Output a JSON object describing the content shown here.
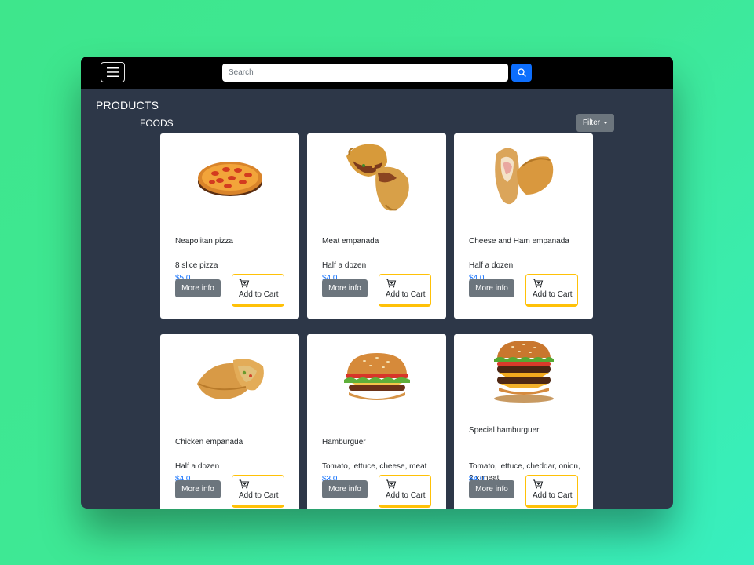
{
  "header": {
    "search_placeholder": "Search"
  },
  "page": {
    "title": "PRODUCTS",
    "section": "FOODS",
    "filter_label": "Filter"
  },
  "buttons": {
    "more_info": "More info",
    "add_to_cart": "Add to Cart"
  },
  "products": [
    {
      "name": "Neapolitan pizza",
      "description": "8 slice pizza",
      "price": "$5.0",
      "image": "pizza"
    },
    {
      "name": "Meat empanada",
      "description": "Half a dozen",
      "price": "$4.0",
      "image": "empanada"
    },
    {
      "name": "Cheese and Ham empanada",
      "description": "Half a dozen",
      "price": "$4.0",
      "image": "empanada-light"
    },
    {
      "name": "Chicken empanada",
      "description": "Half a dozen",
      "price": "$4.0",
      "image": "empanada-open"
    },
    {
      "name": "Hamburguer",
      "description": "Tomato, lettuce, cheese, meat",
      "price": "$3.0",
      "image": "burger"
    },
    {
      "name": "Special hamburguer",
      "description": "Tomato, lettuce, cheddar, onion, 2 x meat",
      "price": "$4.0",
      "image": "double-burger"
    }
  ],
  "colors": {
    "navbar": "#000000",
    "page_bg": "#2d3748",
    "primary": "#0d6efd",
    "secondary": "#6c757d",
    "warning": "#ffc107"
  }
}
